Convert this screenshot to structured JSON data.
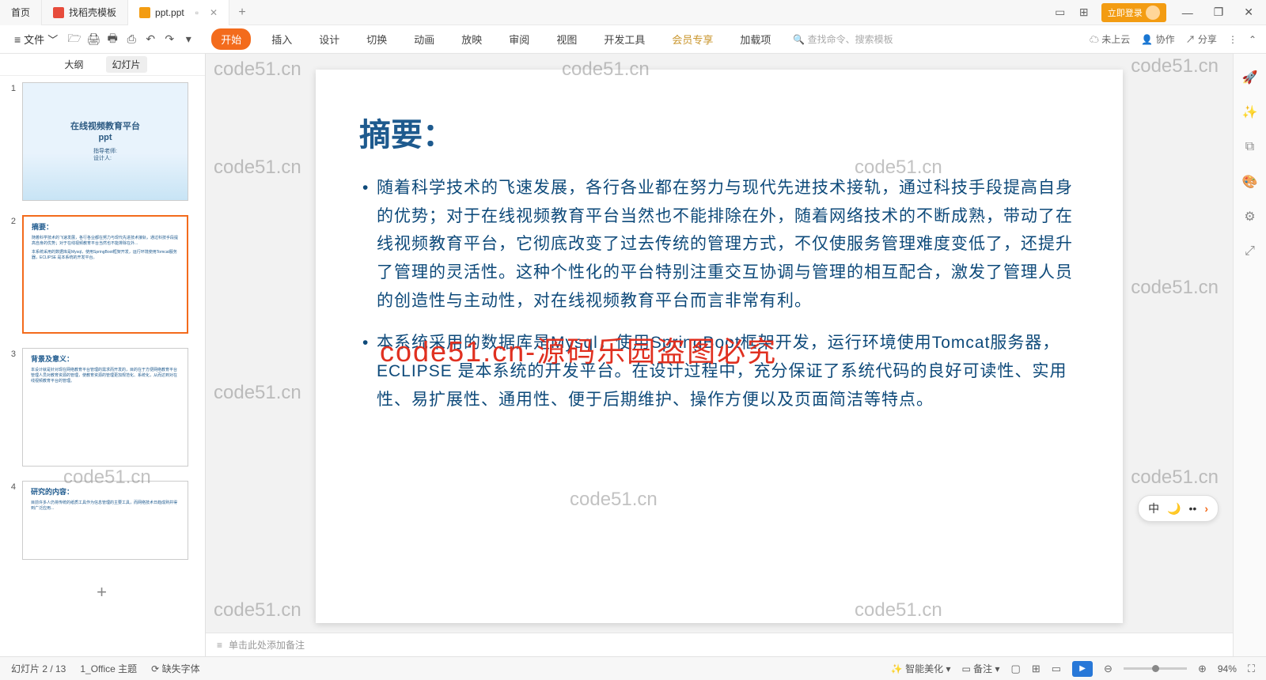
{
  "titlebar": {
    "home": "首页",
    "tab1": "找稻壳模板",
    "tab2": "ppt.ppt",
    "login": "立即登录"
  },
  "ribbon": {
    "file": "文件",
    "tabs": [
      "开始",
      "插入",
      "设计",
      "切换",
      "动画",
      "放映",
      "审阅",
      "视图",
      "开发工具",
      "会员专享",
      "加载项"
    ],
    "search_ph": "查找命令、搜索模板",
    "cloud": "未上云",
    "collab": "协作",
    "share": "分享"
  },
  "thumbs_head": {
    "outline": "大纲",
    "slides": "幻灯片"
  },
  "thumb1": {
    "title": "在线视频教育平台\nppt",
    "sub": "指导老师:\n设计人:"
  },
  "thumb2": {
    "title": "摘要：",
    "t1": "随着科学技术的飞速发展，各行各业都在努力与现代先进技术接轨，通过科技手段提高自身的优势；对于在线视频教育平台当然也不能排除在外...",
    "t2": "本系统采用的数据库是Mysql，使用SpringBoot框架开发，运行环境使用Tomcat服务器，ECLIPSE 是本系统的开发平台。"
  },
  "thumb3": {
    "title": "背景及意义："
  },
  "thumb4": {
    "title": "研究的内容："
  },
  "slide": {
    "title": "摘要：",
    "p1": "随着科学技术的飞速发展，各行各业都在努力与现代先进技术接轨，通过科技手段提高自身的优势；对于在线视频教育平台当然也不能排除在外，随着网络技术的不断成熟，带动了在线视频教育平台，它彻底改变了过去传统的管理方式，不仅使服务管理难度变低了，还提升了管理的灵活性。这种个性化的平台特别注重交互协调与管理的相互配合，激发了管理人员的创造性与主动性，对在线视频教育平台而言非常有利。",
    "p2": "本系统采用的数据库是Mysql，使用SpringBoot框架开发，运行环境使用Tomcat服务器，ECLIPSE 是本系统的开发平台。在设计过程中，充分保证了系统代码的良好可读性、实用性、易扩展性、通用性、便于后期维护、操作方便以及页面简洁等特点。"
  },
  "overlay": "code51.cn-源码乐园盗图必究",
  "wm": "code51.cn",
  "notes": "单击此处添加备注",
  "status": {
    "page": "幻灯片 2 / 13",
    "theme": "1_Office 主题",
    "missing": "缺失字体",
    "beautify": "智能美化",
    "note": "备注",
    "zoom": "94%"
  },
  "floater": {
    "cn": "中"
  }
}
